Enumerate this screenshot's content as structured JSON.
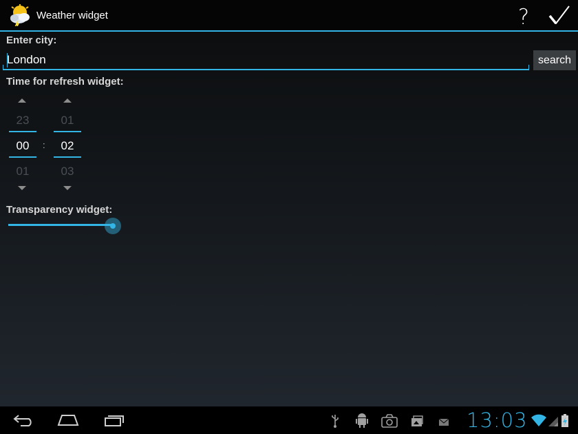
{
  "action_bar": {
    "title": "Weather widget",
    "help_label": "?",
    "app_icon": "weather-sun-cloud-icon",
    "done_icon": "checkmark-icon"
  },
  "city": {
    "label": "Enter city:",
    "value": "London",
    "search_label": "search"
  },
  "refresh": {
    "label": "Time for refresh widget:",
    "hours": {
      "prev": "23",
      "current": "00",
      "next": "01"
    },
    "minutes": {
      "prev": "01",
      "current": "02",
      "next": "03"
    },
    "separator": ":"
  },
  "transparency": {
    "label": "Transparency widget:",
    "level_fraction": 1.0
  },
  "navigation_bar": {
    "back_icon": "back-icon",
    "home_icon": "home-icon",
    "recent_icon": "recent-apps-icon"
  },
  "status_bar": {
    "time": "13:03",
    "icons": [
      "usb-icon",
      "android-debug-icon",
      "camera-icon",
      "gallery-icon",
      "mail-icon",
      "wifi-icon",
      "signal-icon",
      "battery-icon"
    ]
  },
  "colors": {
    "accent": "#33b5e5",
    "background_top": "#0b0c0d",
    "background_bottom": "#222830",
    "button": "#3b3e41"
  }
}
